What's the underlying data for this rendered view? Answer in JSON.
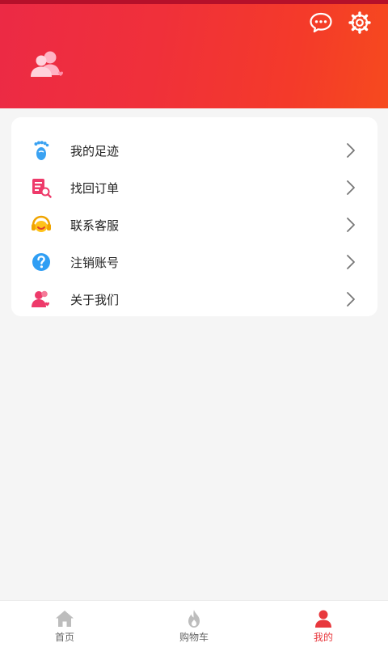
{
  "colors": {
    "accent": "#e8383d",
    "header_start": "#ec2a45",
    "header_end": "#f64a1e",
    "page_bg": "#f5f5f5",
    "tab_inactive": "#999999"
  },
  "header": {
    "message_icon": "chat-bubble-icon",
    "settings_icon": "gear-icon",
    "avatar_icon": "users-icon"
  },
  "menu": {
    "items": [
      {
        "label": "我的足迹",
        "icon": "footprint-icon"
      },
      {
        "label": "找回订单",
        "icon": "order-search-icon"
      },
      {
        "label": "联系客服",
        "icon": "customer-service-icon"
      },
      {
        "label": "注销账号",
        "icon": "question-icon"
      },
      {
        "label": "关于我们",
        "icon": "about-us-icon"
      }
    ]
  },
  "tabbar": {
    "tabs": [
      {
        "label": "首页",
        "icon": "home-icon",
        "active": false
      },
      {
        "label": "购物车",
        "icon": "cart-flame-icon",
        "active": false
      },
      {
        "label": "我的",
        "icon": "user-icon",
        "active": true
      }
    ]
  }
}
